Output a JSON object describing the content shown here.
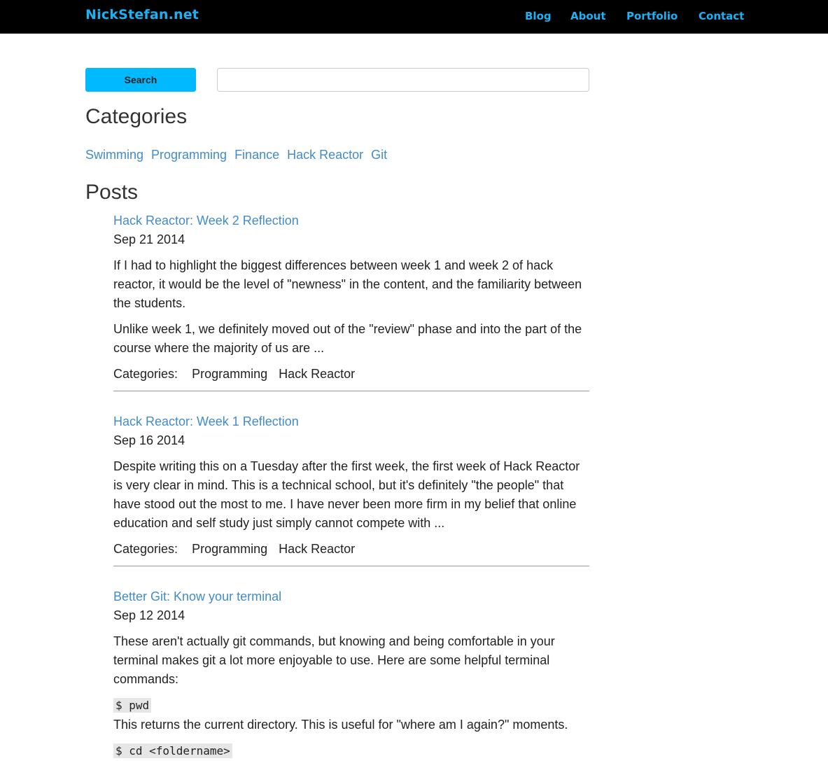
{
  "navbar": {
    "brand": "NickStefan.net",
    "links": [
      "Blog",
      "About",
      "Portfolio",
      "Contact"
    ]
  },
  "search": {
    "button_label": "Search",
    "input_value": "",
    "placeholder": ""
  },
  "categories": {
    "heading": "Categories",
    "items": [
      "Swimming",
      "Programming",
      "Finance",
      "Hack Reactor",
      "Git"
    ]
  },
  "posts": {
    "heading": "Posts",
    "items": [
      {
        "title": "Hack Reactor: Week 2 Reflection",
        "date": "Sep 21 2014",
        "paragraphs": [
          "If I had to highlight the biggest differences between week 1 and week 2 of hack reactor, it would be the level of \"newness\" in the content, and the familiarity between the students.",
          "Unlike week 1, we definitely moved out of the \"review\" phase and into the part of the course where the majority of us are ..."
        ],
        "categories_label": "Categories:",
        "categories": [
          "Programming",
          "Hack Reactor"
        ]
      },
      {
        "title": "Hack Reactor: Week 1 Reflection",
        "date": "Sep 16 2014",
        "paragraphs": [
          "Despite writing this on a Tuesday after the first week, the first week of Hack Reactor is very clear in mind. This is a technical school, but it's definitely \"the people\" that have stood out the most to me. I have never been more firm in my belief that online education and self study just simply cannot compete with ..."
        ],
        "categories_label": "Categories:",
        "categories": [
          "Programming",
          "Hack Reactor"
        ]
      },
      {
        "title": "Better Git: Know your terminal",
        "date": "Sep 12 2014",
        "paragraphs": [
          "These aren't actually git commands, but knowing and being comfortable in your terminal makes git a lot more enjoyable to use. Here are some helpful terminal commands:"
        ],
        "code_1": "$ pwd",
        "code_1_desc": "This returns the current directory. This is useful for \"where am I again?\" moments.",
        "code_2": "$ cd <foldername>"
      }
    ]
  }
}
